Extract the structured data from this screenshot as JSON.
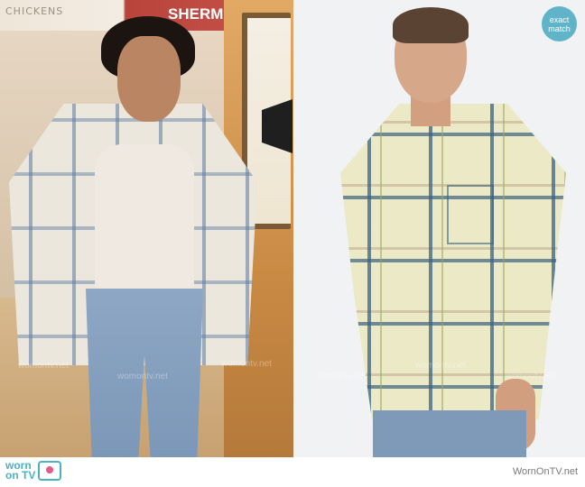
{
  "left_panel": {
    "store_sign_1": "CHICKENS",
    "store_sign_2": "SHERMA"
  },
  "badge": {
    "line1": "exact",
    "line2": "match"
  },
  "watermarks": [
    "womontv.net",
    "womontv.net",
    "womontv.net",
    "womontv.net",
    "womontv.net",
    "womontv.net"
  ],
  "footer": {
    "logo_line1": "worn",
    "logo_line2": "on",
    "logo_line3": "TV",
    "site": "WornOnTV.net"
  }
}
